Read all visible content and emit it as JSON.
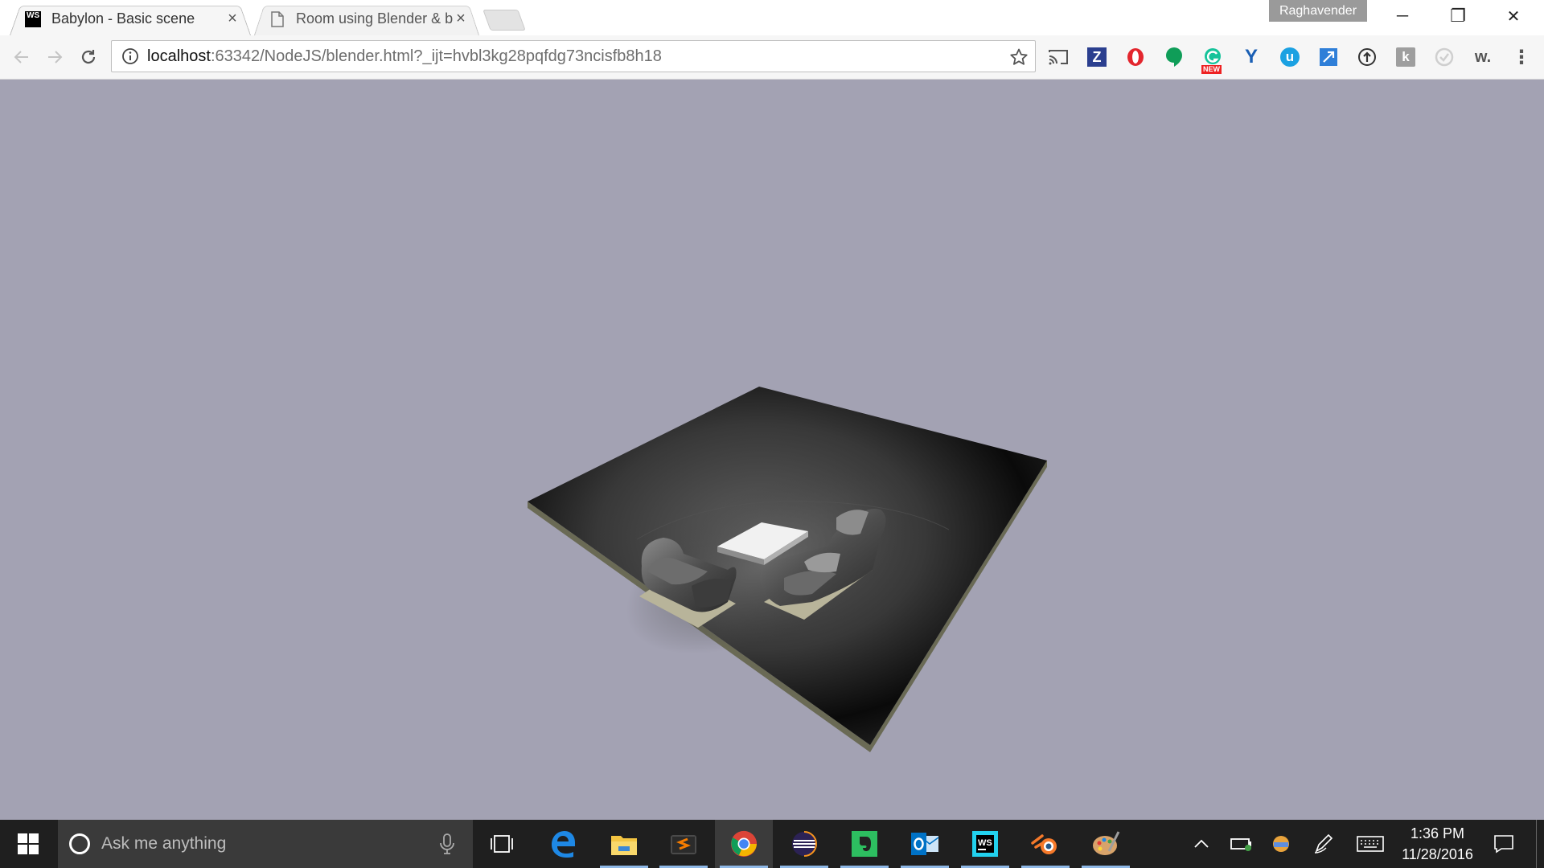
{
  "browser": {
    "tabs": [
      {
        "title": "Babylon - Basic scene",
        "favicon": "webstorm-icon",
        "active": true
      },
      {
        "title": "Room using Blender & ba",
        "favicon": "document-icon",
        "active": false
      }
    ],
    "close_glyph": "×",
    "profile_name": "Raghavender",
    "window_controls": {
      "minimize": "─",
      "restore": "❐",
      "close": "✕"
    },
    "address": {
      "host": "localhost",
      "rest": ":63342/NodeJS/blender.html?_ijt=hvbl3kg28pqfdg73ncisfb8h18"
    },
    "extensions": [
      {
        "name": "cast-icon"
      },
      {
        "name": "zotero-icon",
        "glyph": "Z",
        "color": "#2b3f8f"
      },
      {
        "name": "opera-icon",
        "color": "#e3262e"
      },
      {
        "name": "hangouts-icon",
        "color": "#0f9d58"
      },
      {
        "name": "grammarly-icon",
        "color": "#15c39a",
        "badge": "NEW"
      },
      {
        "name": "vimeo-icon",
        "glyph": "Y",
        "color": "#1a73e8"
      },
      {
        "name": "u-icon",
        "glyph": "u",
        "color": "#1ba1e2"
      },
      {
        "name": "expand-icon",
        "color": "#2f7fd8"
      },
      {
        "name": "pushbullet-icon",
        "color": "#333333"
      },
      {
        "name": "k-icon",
        "glyph": "k",
        "color": "#9e9e9e"
      },
      {
        "name": "loading-icon",
        "color": "#bdbdbd"
      },
      {
        "name": "wappalyzer-icon",
        "glyph": "w.",
        "color": "#555555"
      },
      {
        "name": "menu-icon",
        "glyph": "⋮",
        "color": "#555555"
      }
    ]
  },
  "taskbar": {
    "search_placeholder": "Ask me anything",
    "apps": [
      {
        "name": "task-view-icon"
      },
      {
        "name": "edge-icon",
        "color": "#1e88e5"
      },
      {
        "name": "file-explorer-icon",
        "color": "#f4c542"
      },
      {
        "name": "sublime-text-icon",
        "color": "#f57c00"
      },
      {
        "name": "chrome-icon",
        "active": true
      },
      {
        "name": "eclipse-icon",
        "color": "#3a2f87"
      },
      {
        "name": "evernote-icon",
        "color": "#2dbe60"
      },
      {
        "name": "outlook-icon",
        "color": "#0072c6"
      },
      {
        "name": "webstorm-icon",
        "color": "#22d1ee"
      },
      {
        "name": "blender-icon",
        "color": "#f5792a"
      },
      {
        "name": "paint-icon",
        "color": "#d8a36a"
      }
    ],
    "time": "1:36 PM",
    "date": "11/28/2016"
  },
  "scene": {
    "background": "#a3a2b3",
    "floor_color": "#1d1d1d",
    "sofa_color": "#5a5a5a",
    "table_top_color": "#e8e8e8"
  }
}
